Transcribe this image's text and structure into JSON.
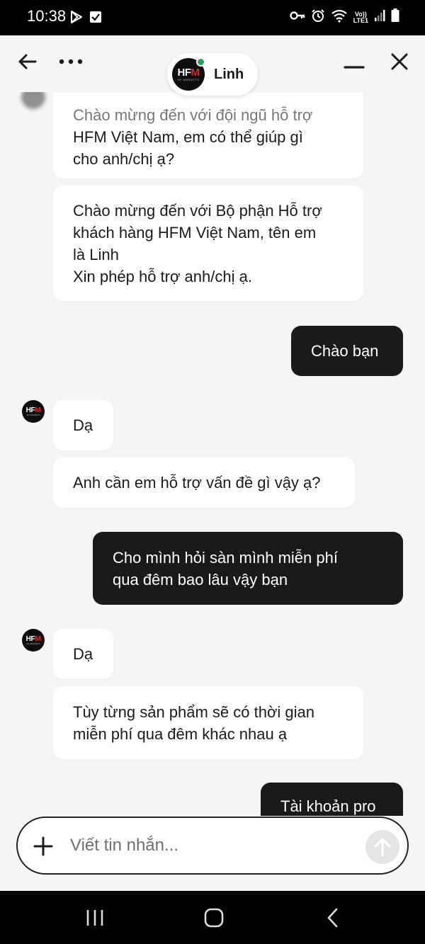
{
  "status_bar": {
    "time": "10:38",
    "network_label_top": "Vo))",
    "network_label_bottom": "LTE1",
    "icons": [
      "play-store-icon",
      "checkbox-icon",
      "vpn-key-icon",
      "alarm-icon",
      "wifi-icon",
      "signal-icon",
      "battery-icon"
    ]
  },
  "header": {
    "agent_name": "Linh",
    "avatar_logo_hf": "HF",
    "avatar_logo_m": "M",
    "avatar_logo_sub": "HF MARKETS",
    "status_color": "#22a55a",
    "icons": [
      "back-arrow-icon",
      "more-options-icon",
      "minimize-icon",
      "close-icon"
    ]
  },
  "messages": [
    {
      "sender": "agent",
      "lines": [
        "Chào mừng đến với đội ngũ hỗ trợ",
        "HFM Việt Nam, em có thể giúp gì",
        "cho anh/chị ạ?"
      ]
    },
    {
      "sender": "agent",
      "lines": [
        "Chào mừng đến với Bộ phận Hỗ trợ",
        "khách hàng HFM Việt Nam, tên em",
        "là Linh",
        "Xin phép hỗ trợ anh/chị ạ."
      ]
    },
    {
      "sender": "user",
      "lines": [
        "Chào bạn"
      ]
    },
    {
      "sender": "agent",
      "lines": [
        "Dạ"
      ]
    },
    {
      "sender": "agent",
      "lines": [
        "Anh cần em hỗ trợ vấn đề gì vậy ạ?"
      ]
    },
    {
      "sender": "user",
      "lines": [
        "Cho mình hỏi sàn mình miễn phí",
        "qua đêm bao lâu vậy bạn"
      ]
    },
    {
      "sender": "agent",
      "lines": [
        "Dạ"
      ]
    },
    {
      "sender": "agent",
      "lines": [
        "Tùy từng sản phẩm sẽ có thời gian",
        "miễn phí qua đêm khác nhau ạ"
      ]
    },
    {
      "sender": "user",
      "lines": [
        "Tài khoản pro"
      ]
    }
  ],
  "composer": {
    "placeholder": "Viết tin nhắn...",
    "value": ""
  },
  "colors": {
    "user_bubble": "#1a1a1a",
    "agent_bubble": "#ffffff",
    "background": "#f5f5f5",
    "brand_red": "#d7262e"
  }
}
